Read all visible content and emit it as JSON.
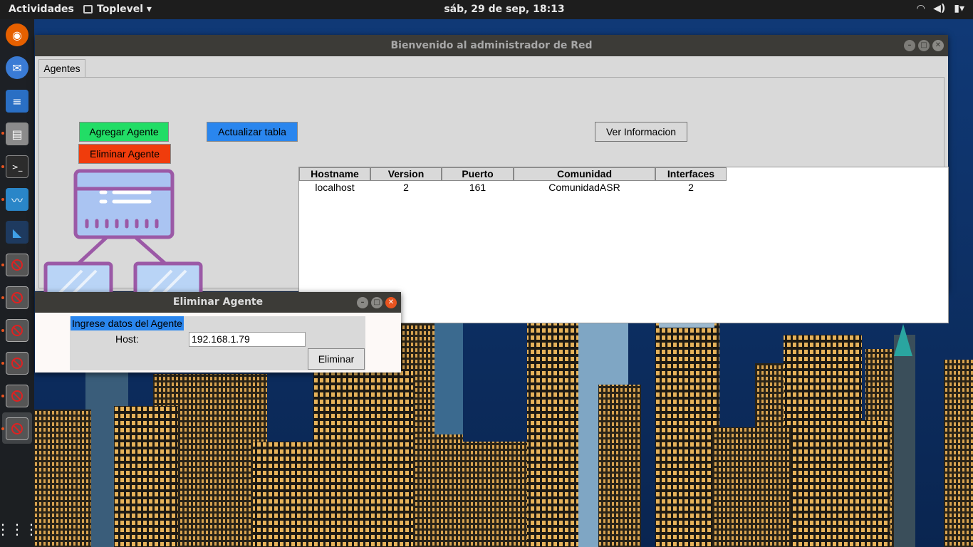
{
  "topbar": {
    "activities": "Actividades",
    "app_name": "Toplevel ▾",
    "clock": "sáb, 29 de sep, 18:13",
    "tray_icons": [
      "wifi-icon",
      "volume-icon",
      "battery-icon"
    ]
  },
  "dock": {
    "items": [
      "firefox-icon",
      "thunderbird-icon",
      "writer-icon",
      "files-icon",
      "terminal-icon",
      "monitor-icon",
      "vscode-icon",
      "tk-app-icon",
      "tk-app-icon",
      "tk-app-icon",
      "tk-app-icon",
      "tk-app-icon",
      "tk-app-icon",
      "app-grid-icon"
    ]
  },
  "main_window": {
    "title": "Bienvenido al administrador de Red",
    "tab_label": "Agentes",
    "buttons": {
      "agregar": "Agregar Agente",
      "eliminar": "Eliminar Agente",
      "actualizar": "Actualizar tabla",
      "ver_info": "Ver Informacion"
    },
    "table": {
      "headers": [
        "Hostname",
        "Version",
        "Puerto",
        "Comunidad",
        "Interfaces"
      ],
      "rows": [
        [
          "localhost",
          "2",
          "161",
          "ComunidadASR",
          "2"
        ]
      ]
    },
    "illustration": "network-topology-icon"
  },
  "dialog": {
    "title": "Eliminar Agente",
    "frame_label": "Ingrese datos del Agente",
    "host_label": "Host:",
    "host_value": "192.168.1.79",
    "button": "Eliminar"
  },
  "colors": {
    "agregar": "#22dd66",
    "eliminar": "#f03c0c",
    "actualizar": "#2a86ee",
    "titlebar": "#3c3b37",
    "window_bg": "#d9d9d9",
    "illustration": "#9b59a6"
  }
}
